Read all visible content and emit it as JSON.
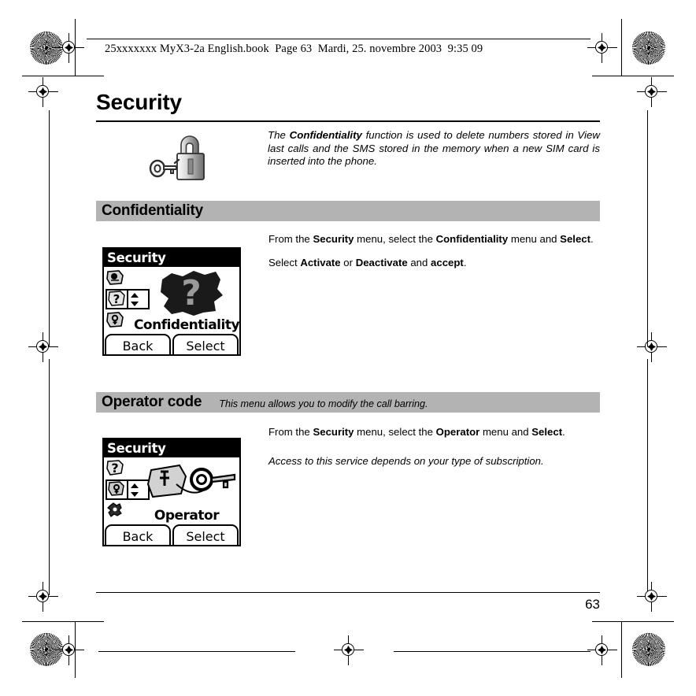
{
  "print_header": "25xxxxxxx MyX3-2a English.book  Page 63  Mardi, 25. novembre 2003  9:35 09",
  "page_title": "Security",
  "intro": {
    "icon": "padlock-key-icon",
    "text_before": "The ",
    "text_bold": "Confidentiality",
    "text_after": " function is used to delete numbers stored in View last calls and the SMS stored in the memory when a new SIM card is inserted into the phone."
  },
  "sections": [
    {
      "bar_title": "Confidentiality",
      "bar_subtitle": "",
      "lines": [
        {
          "segments": [
            {
              "t": "From the ",
              "b": false
            },
            {
              "t": "Security",
              "b": true
            },
            {
              "t": " menu, select the ",
              "b": false
            },
            {
              "t": "Confidentiality",
              "b": true
            },
            {
              "t": " menu and ",
              "b": false
            },
            {
              "t": "Select",
              "b": true
            },
            {
              "t": ".",
              "b": false
            }
          ],
          "italic": false
        },
        {
          "segments": [
            {
              "t": "Select ",
              "b": false
            },
            {
              "t": "Activate",
              "b": true
            },
            {
              "t": " or ",
              "b": false
            },
            {
              "t": "Deactivate",
              "b": true
            },
            {
              "t": " and ",
              "b": false
            },
            {
              "t": "accept",
              "b": true
            },
            {
              "t": ".",
              "b": false
            }
          ],
          "italic": false
        }
      ],
      "screenshot": {
        "title": "Security",
        "graphic": "question-mark-icon",
        "label": "Confidentiality",
        "softkey_left": "Back",
        "softkey_right": "Select"
      }
    },
    {
      "bar_title": "Operator code",
      "bar_subtitle": "This menu allows you to modify the call barring.",
      "lines": [
        {
          "segments": [
            {
              "t": "From the ",
              "b": false
            },
            {
              "t": "Security",
              "b": true
            },
            {
              "t": " menu, select the ",
              "b": false
            },
            {
              "t": "Operator",
              "b": true
            },
            {
              "t": " menu and ",
              "b": false
            },
            {
              "t": "Select",
              "b": true
            },
            {
              "t": ".",
              "b": false
            }
          ],
          "italic": false
        },
        {
          "segments": [
            {
              "t": "Access to this service depends on your type of subscription.",
              "b": false
            }
          ],
          "italic": true
        }
      ],
      "screenshot": {
        "title": "Security",
        "graphic": "operator-key-icon",
        "label": "Operator",
        "softkey_left": "Back",
        "softkey_right": "Select"
      }
    }
  ],
  "page_number": "63",
  "colors": {
    "section_bar": "#b3b3b3",
    "text": "#000000",
    "background": "#ffffff"
  }
}
